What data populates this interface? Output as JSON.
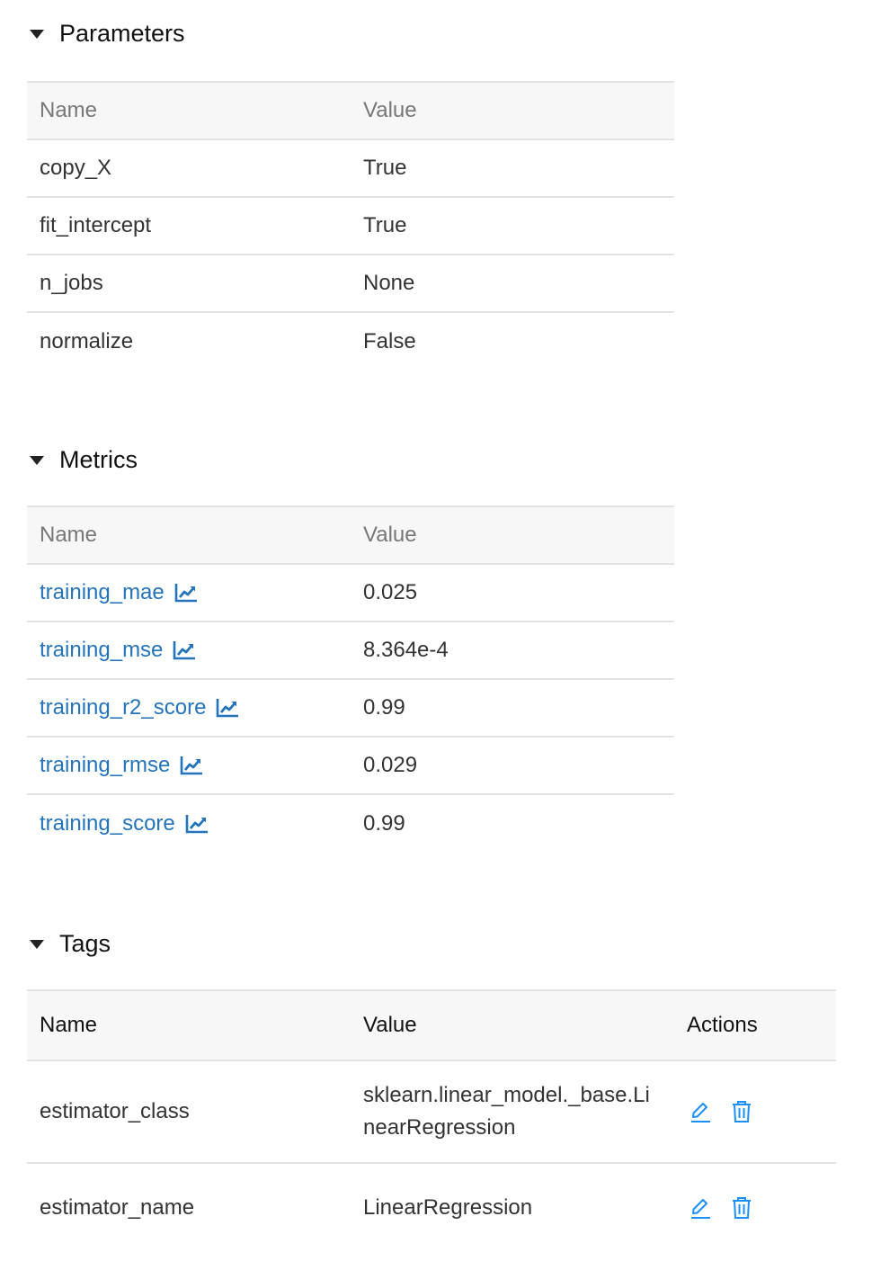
{
  "parameters": {
    "title": "Parameters",
    "columns": [
      "Name",
      "Value"
    ],
    "rows": [
      {
        "name": "copy_X",
        "value": "True"
      },
      {
        "name": "fit_intercept",
        "value": "True"
      },
      {
        "name": "n_jobs",
        "value": "None"
      },
      {
        "name": "normalize",
        "value": "False"
      }
    ]
  },
  "metrics": {
    "title": "Metrics",
    "columns": [
      "Name",
      "Value"
    ],
    "rows": [
      {
        "name": "training_mae",
        "value": "0.025"
      },
      {
        "name": "training_mse",
        "value": "8.364e-4"
      },
      {
        "name": "training_r2_score",
        "value": "0.99"
      },
      {
        "name": "training_rmse",
        "value": "0.029"
      },
      {
        "name": "training_score",
        "value": "0.99"
      }
    ]
  },
  "tags": {
    "title": "Tags",
    "columns": [
      "Name",
      "Value",
      "Actions"
    ],
    "rows": [
      {
        "name": "estimator_class",
        "value": "sklearn.linear_model._base.LinearRegression"
      },
      {
        "name": "estimator_name",
        "value": "LinearRegression"
      }
    ]
  },
  "icons": {
    "section_toggle": "caret-down-icon",
    "metric_chart": "line-chart-icon",
    "edit": "edit-pencil-icon",
    "delete": "trash-icon"
  },
  "colors": {
    "link": "#2374bb",
    "action_icon": "#1890ff",
    "header_bg": "#f7f7f7",
    "border": "#e3e3e3"
  }
}
